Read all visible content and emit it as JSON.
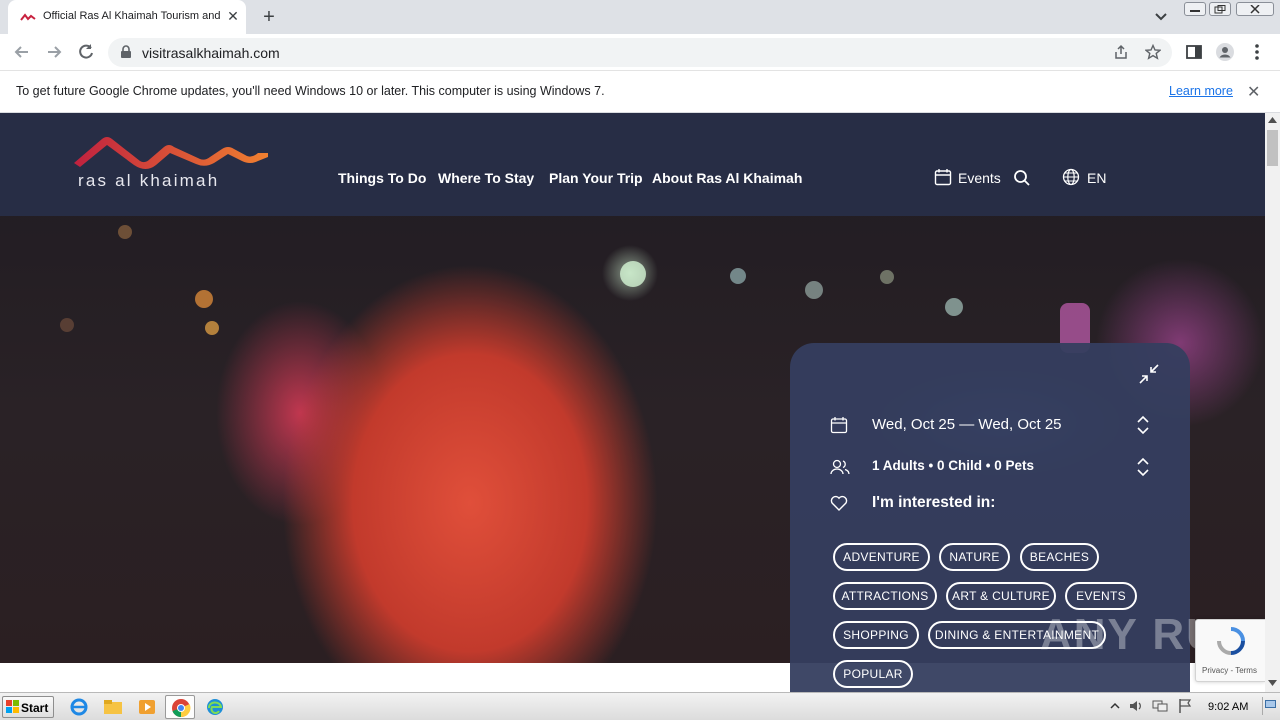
{
  "browser": {
    "tab_title": "Official Ras Al Khaimah Tourism and V",
    "url": "visitrasalkhaimah.com",
    "infobar_message": "To get future Google Chrome updates, you'll need Windows 10 or later. This computer is using Windows 7.",
    "infobar_link": "Learn more"
  },
  "site": {
    "logo_text": "ras al khaimah",
    "nav": [
      "Things To Do",
      "Where To Stay",
      "Plan Your Trip",
      "About Ras Al Khaimah"
    ],
    "events_label": "Events",
    "language": "EN"
  },
  "booking": {
    "dates": "Wed, Oct 25 — Wed, Oct 25",
    "guests": "1 Adults  •  0 Child  •  0 Pets",
    "interest_label": "I'm interested in:",
    "chips": [
      "ADVENTURE",
      "NATURE",
      "BEACHES",
      "ATTRACTIONS",
      "ART & CULTURE",
      "EVENTS",
      "SHOPPING",
      "DINING & ENTERTAINMENT",
      "POPULAR"
    ]
  },
  "overlay": {
    "watermark": "ANY RUN",
    "recaptcha_terms": "Privacy - Terms"
  },
  "taskbar": {
    "start_label": "Start",
    "clock": "9:02 AM"
  },
  "colors": {
    "header_bg": "#282e48",
    "panel_bg": "#353e5f",
    "logo_red": "#c0213f",
    "logo_orange": "#f08030",
    "link_blue": "#1a73e8"
  }
}
